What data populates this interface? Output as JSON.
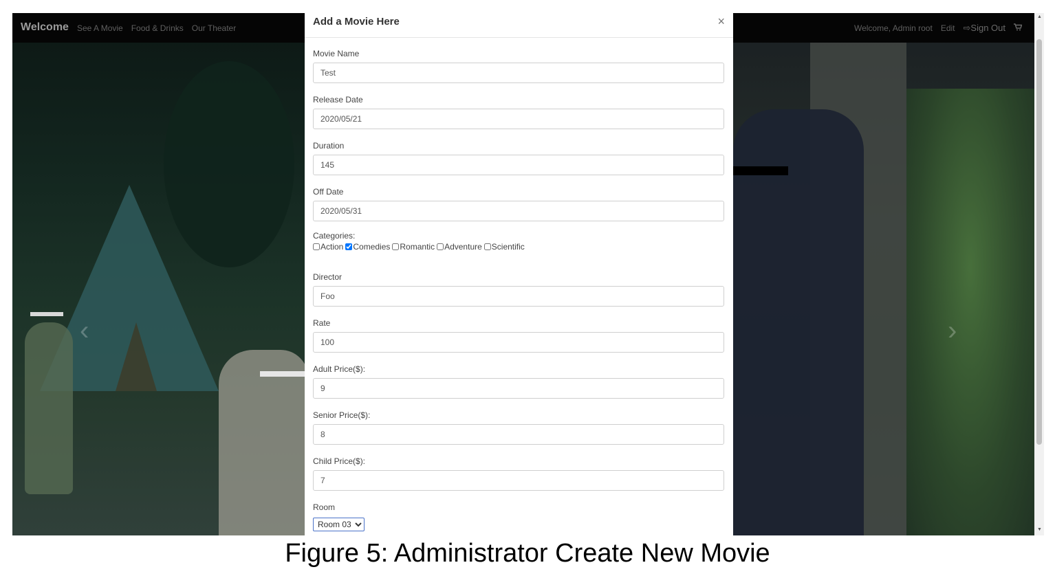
{
  "navbar": {
    "brand": "Welcome",
    "links": [
      "See A Movie",
      "Food & Drinks",
      "Our Theater"
    ],
    "welcome_text": "Welcome, Admin root",
    "edit_label": "Edit",
    "signout_label": "Sign Out",
    "signout_icon": "sign-out-icon",
    "cart_icon": "cart-icon"
  },
  "carousel": {
    "prev_icon": "chevron-left-icon",
    "next_icon": "chevron-right-icon"
  },
  "modal": {
    "title": "Add a Movie Here",
    "close_label": "×",
    "fields": {
      "movie_name": {
        "label": "Movie Name",
        "value": "Test"
      },
      "release_date": {
        "label": "Release Date",
        "value": "2020/05/21"
      },
      "duration": {
        "label": "Duration",
        "value": "145"
      },
      "off_date": {
        "label": "Off Date",
        "value": "2020/05/31"
      },
      "director": {
        "label": "Director",
        "value": "Foo"
      },
      "rate": {
        "label": "Rate",
        "value": "100"
      },
      "adult_price": {
        "label": "Adult Price($):",
        "value": "9"
      },
      "senior_price": {
        "label": "Senior Price($):",
        "value": "8"
      },
      "child_price": {
        "label": "Child Price($):",
        "value": "7"
      }
    },
    "categories": {
      "label": "Categories:",
      "items": [
        {
          "label": "Action",
          "checked": false
        },
        {
          "label": "Comedies",
          "checked": true
        },
        {
          "label": "Romantic",
          "checked": false
        },
        {
          "label": "Adventure",
          "checked": false
        },
        {
          "label": "Scientific",
          "checked": false
        }
      ]
    },
    "room": {
      "label": "Room",
      "selected": "Room 03"
    }
  },
  "caption": "Figure 5: Administrator Create New Movie"
}
